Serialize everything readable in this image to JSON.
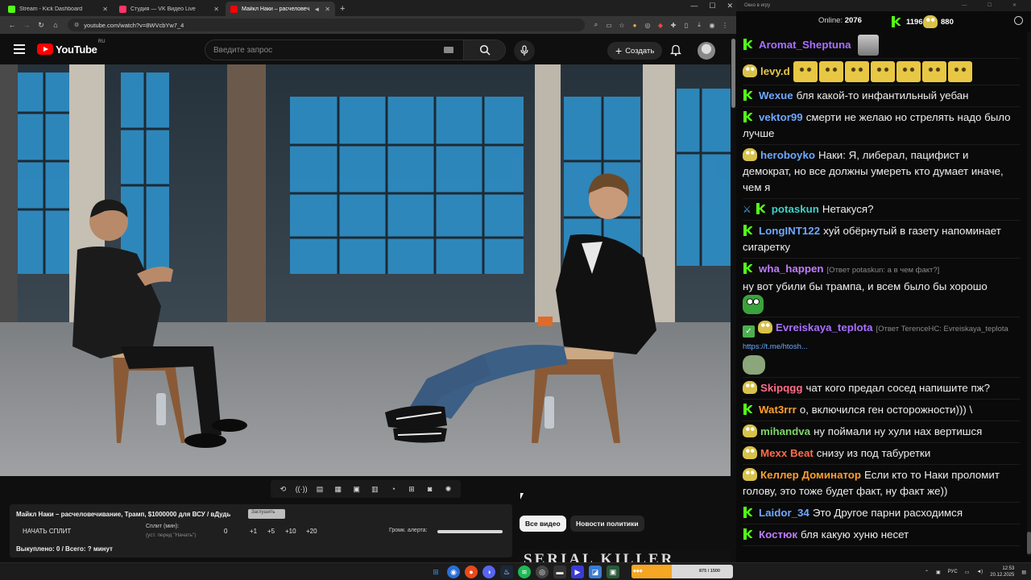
{
  "browser": {
    "tabs": [
      {
        "label": "Stream - Kick Dashboard",
        "color": "#53fc18",
        "active": false
      },
      {
        "label": "Студия — VK Видео Live",
        "color": "#ff3366",
        "active": false
      },
      {
        "label": "Майкл Наки – расчеловеч...",
        "color": "#ff0000",
        "active": true
      }
    ],
    "url": "youtube.com/watch?v=8WVcbYw7_4"
  },
  "youtube": {
    "logo_text": "YouTube",
    "region": "RU",
    "search_placeholder": "Введите запрос",
    "create_label": "Создать"
  },
  "panel": {
    "title": "Майкл Наки – расчеловечивание, Трамп, $1000000 для ВСУ / вДудь",
    "tag": "Заглушить",
    "start_split": "НАЧАТЬ СПЛИТ",
    "split_label": "Сплит (мин):",
    "split_hint": "(уст. перед \"Начать\")",
    "split_value": "0",
    "increments": [
      "+1",
      "+5",
      "+10",
      "+20"
    ],
    "alert_label": "Громк. алерта:",
    "bought": "Выкуплено: 0 / Всего: ? минут"
  },
  "chips": {
    "all": "Все видео",
    "news": "Новости политики"
  },
  "thumb_text": "SERIAL KILLER",
  "chat": {
    "window_title": "Окно в игру",
    "online_label": "Online:",
    "online_count": "2076",
    "kick_count": "1196",
    "vk_count": "880",
    "messages": [
      {
        "user": "Aromat_Sheptuna",
        "color": "#a970ff",
        "badges": [
          "kick"
        ],
        "text": ""
      },
      {
        "user": "levy.d",
        "color": "#e6c84a",
        "badges": [
          "pepe"
        ],
        "text": ""
      },
      {
        "user": "Wexue",
        "color": "#6fa8ff",
        "badges": [
          "kick"
        ],
        "text": "бля какой-то инфантильный уебан"
      },
      {
        "user": "vektor99",
        "color": "#6fa8ff",
        "badges": [
          "kick"
        ],
        "text": "смерти не желаю но стрелять надо было лучше"
      },
      {
        "user": "heroboyko",
        "color": "#6fa8ff",
        "badges": [
          "pepe"
        ],
        "text": "Наки: Я, либерал, пацифист и демократ, но все должны умереть кто думает иначе, чем я"
      },
      {
        "user": "potaskun",
        "color": "#3fd0c8",
        "badges": [
          "sword",
          "kick"
        ],
        "text": "Нетакуся?"
      },
      {
        "user": "LongINT122",
        "color": "#6fa8ff",
        "badges": [
          "kick"
        ],
        "text": "хуй обёрнутый в газету напоминает сигаретку"
      },
      {
        "user": "wha_happen",
        "color": "#c07bff",
        "badges": [
          "kick"
        ],
        "reply": "[Ответ potaskun: а в чем факт?]",
        "text": "ну вот убили бы трампа, и всем было бы хорошо"
      },
      {
        "user": "Evreiskaya_teplota",
        "color": "#a970ff",
        "badges": [
          "check",
          "pepe"
        ],
        "reply": "[Ответ TerenceHC: Evreiskaya_teplota",
        "link": "https://t.me/htosh...",
        "text": ""
      },
      {
        "user": "Skipqgg",
        "color": "#ff6b8a",
        "badges": [
          "pepe"
        ],
        "text": "чат кого предал сосед напишите пж?"
      },
      {
        "user": "Wat3rrr",
        "color": "#ff9f2e",
        "badges": [
          "kick"
        ],
        "text": "о, включился ген осторожности))) \\"
      },
      {
        "user": "mihandva",
        "color": "#7fd46a",
        "badges": [
          "pepe"
        ],
        "text": "ну поймали ну хули нах вертишся"
      },
      {
        "user": "Mexx Beat",
        "color": "#ff6b4a",
        "badges": [
          "pepe"
        ],
        "text": "снизу из под табуретки"
      },
      {
        "user": "Келлер Доминатор",
        "color": "#ff9f2e",
        "badges": [
          "pepe"
        ],
        "text": "Если кто то Наки проломит голову, это тоже будет факт, ну факт же))"
      },
      {
        "user": "Laidor_34",
        "color": "#6fa8ff",
        "badges": [
          "kick"
        ],
        "text": "Это Другое парни расходимся"
      },
      {
        "user": "Костюк",
        "color": "#c07bff",
        "badges": [
          "kick"
        ],
        "text": "бля какую хуню несет"
      }
    ]
  },
  "taskbar": {
    "kick_widget_count": "875 / 1500",
    "lang": "РУС",
    "time": "12:53",
    "date": "20.12.2025"
  }
}
